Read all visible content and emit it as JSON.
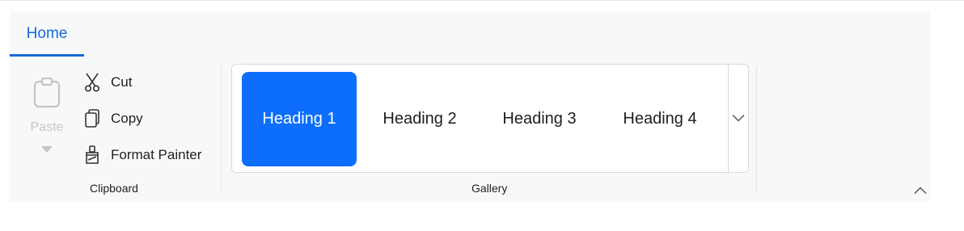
{
  "ribbon": {
    "tabs": [
      {
        "label": "Home",
        "active": true
      }
    ],
    "clipboard": {
      "group_label": "Clipboard",
      "paste": {
        "label": "Paste",
        "icon": "clipboard-icon",
        "disabled": true
      },
      "commands": [
        {
          "label": "Cut",
          "icon": "scissors-icon"
        },
        {
          "label": "Copy",
          "icon": "copy-icon"
        },
        {
          "label": "Format Painter",
          "icon": "format-painter-icon"
        }
      ]
    },
    "gallery": {
      "group_label": "Gallery",
      "items": [
        {
          "label": "Heading 1",
          "selected": true
        },
        {
          "label": "Heading 2",
          "selected": false
        },
        {
          "label": "Heading 3",
          "selected": false
        },
        {
          "label": "Heading 4",
          "selected": false
        }
      ],
      "more_icon": "chevron-down-icon"
    },
    "collapse_icon": "chevron-up-icon"
  },
  "colors": {
    "accent": "#1668dc",
    "selected_fill": "#0d6efd",
    "ribbon_bg": "#f7f8fa",
    "disabled": "#c4c4c4"
  }
}
